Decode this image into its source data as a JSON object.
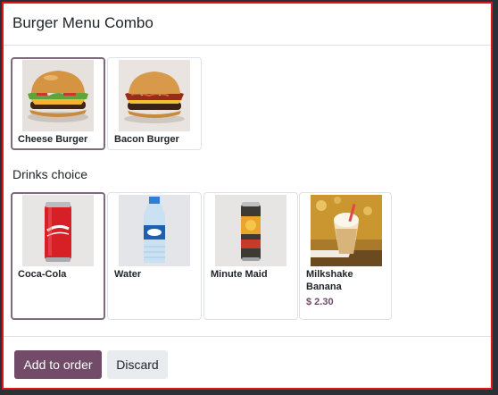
{
  "dialog": {
    "title": "Burger Menu Combo"
  },
  "burgers": {
    "items": [
      {
        "name": "Cheese Burger",
        "selected": true,
        "icon": "cheese-burger-photo"
      },
      {
        "name": "Bacon Burger",
        "selected": false,
        "icon": "bacon-burger-photo"
      }
    ]
  },
  "drinks": {
    "label": "Drinks choice",
    "items": [
      {
        "name": "Coca-Cola",
        "selected": true,
        "icon": "coca-cola-can-photo"
      },
      {
        "name": "Water",
        "selected": false,
        "icon": "water-bottle-photo"
      },
      {
        "name": "Minute Maid",
        "selected": false,
        "icon": "minute-maid-can-photo"
      },
      {
        "name": "Milkshake Banana",
        "price": "$ 2.30",
        "selected": false,
        "icon": "milkshake-photo"
      }
    ]
  },
  "footer": {
    "add_label": "Add to order",
    "discard_label": "Discard"
  },
  "colors": {
    "accent": "#714b67",
    "selection_border": "#7d6a7d",
    "frame": "#e4141b"
  }
}
